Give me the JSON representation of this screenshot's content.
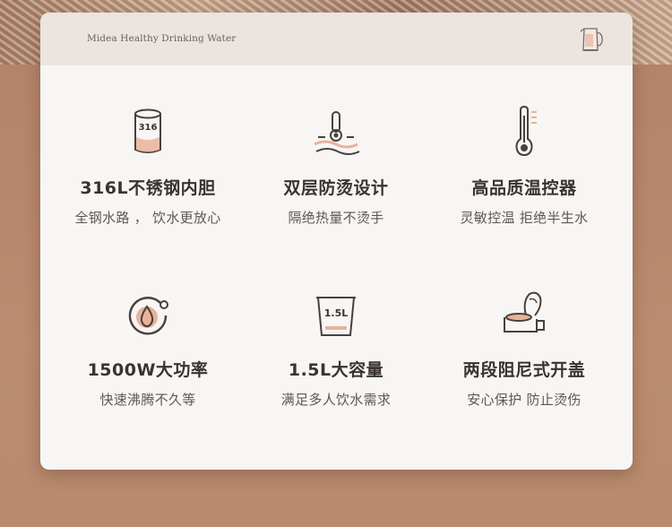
{
  "header": {
    "brand": "Midea Healthy Drinking Water"
  },
  "features": [
    {
      "title": "316L不锈钢内胆",
      "subtitle": "全钢水路 ， 饮水更放心",
      "icon": "steel-cup-316-icon",
      "icon_text": "316"
    },
    {
      "title": "双层防烫设计",
      "subtitle": "隔绝热量不烫手",
      "icon": "heat-insulation-icon"
    },
    {
      "title": "高品质温控器",
      "subtitle": "灵敏控温 拒绝半生水",
      "icon": "thermometer-icon"
    },
    {
      "title": "1500W大功率",
      "subtitle": "快速沸腾不久等",
      "icon": "power-drop-icon"
    },
    {
      "title": "1.5L大容量",
      "subtitle": "满足多人饮水需求",
      "icon": "capacity-jug-icon",
      "icon_text": "1.5L"
    },
    {
      "title": "两段阻尼式开盖",
      "subtitle": "安心保护 防止烫伤",
      "icon": "damped-lid-icon"
    }
  ],
  "colors": {
    "accent": "#e8b39a",
    "icon_stroke": "#4a403b",
    "card": "#f7f6f5",
    "header_band": "#ebe4df"
  }
}
